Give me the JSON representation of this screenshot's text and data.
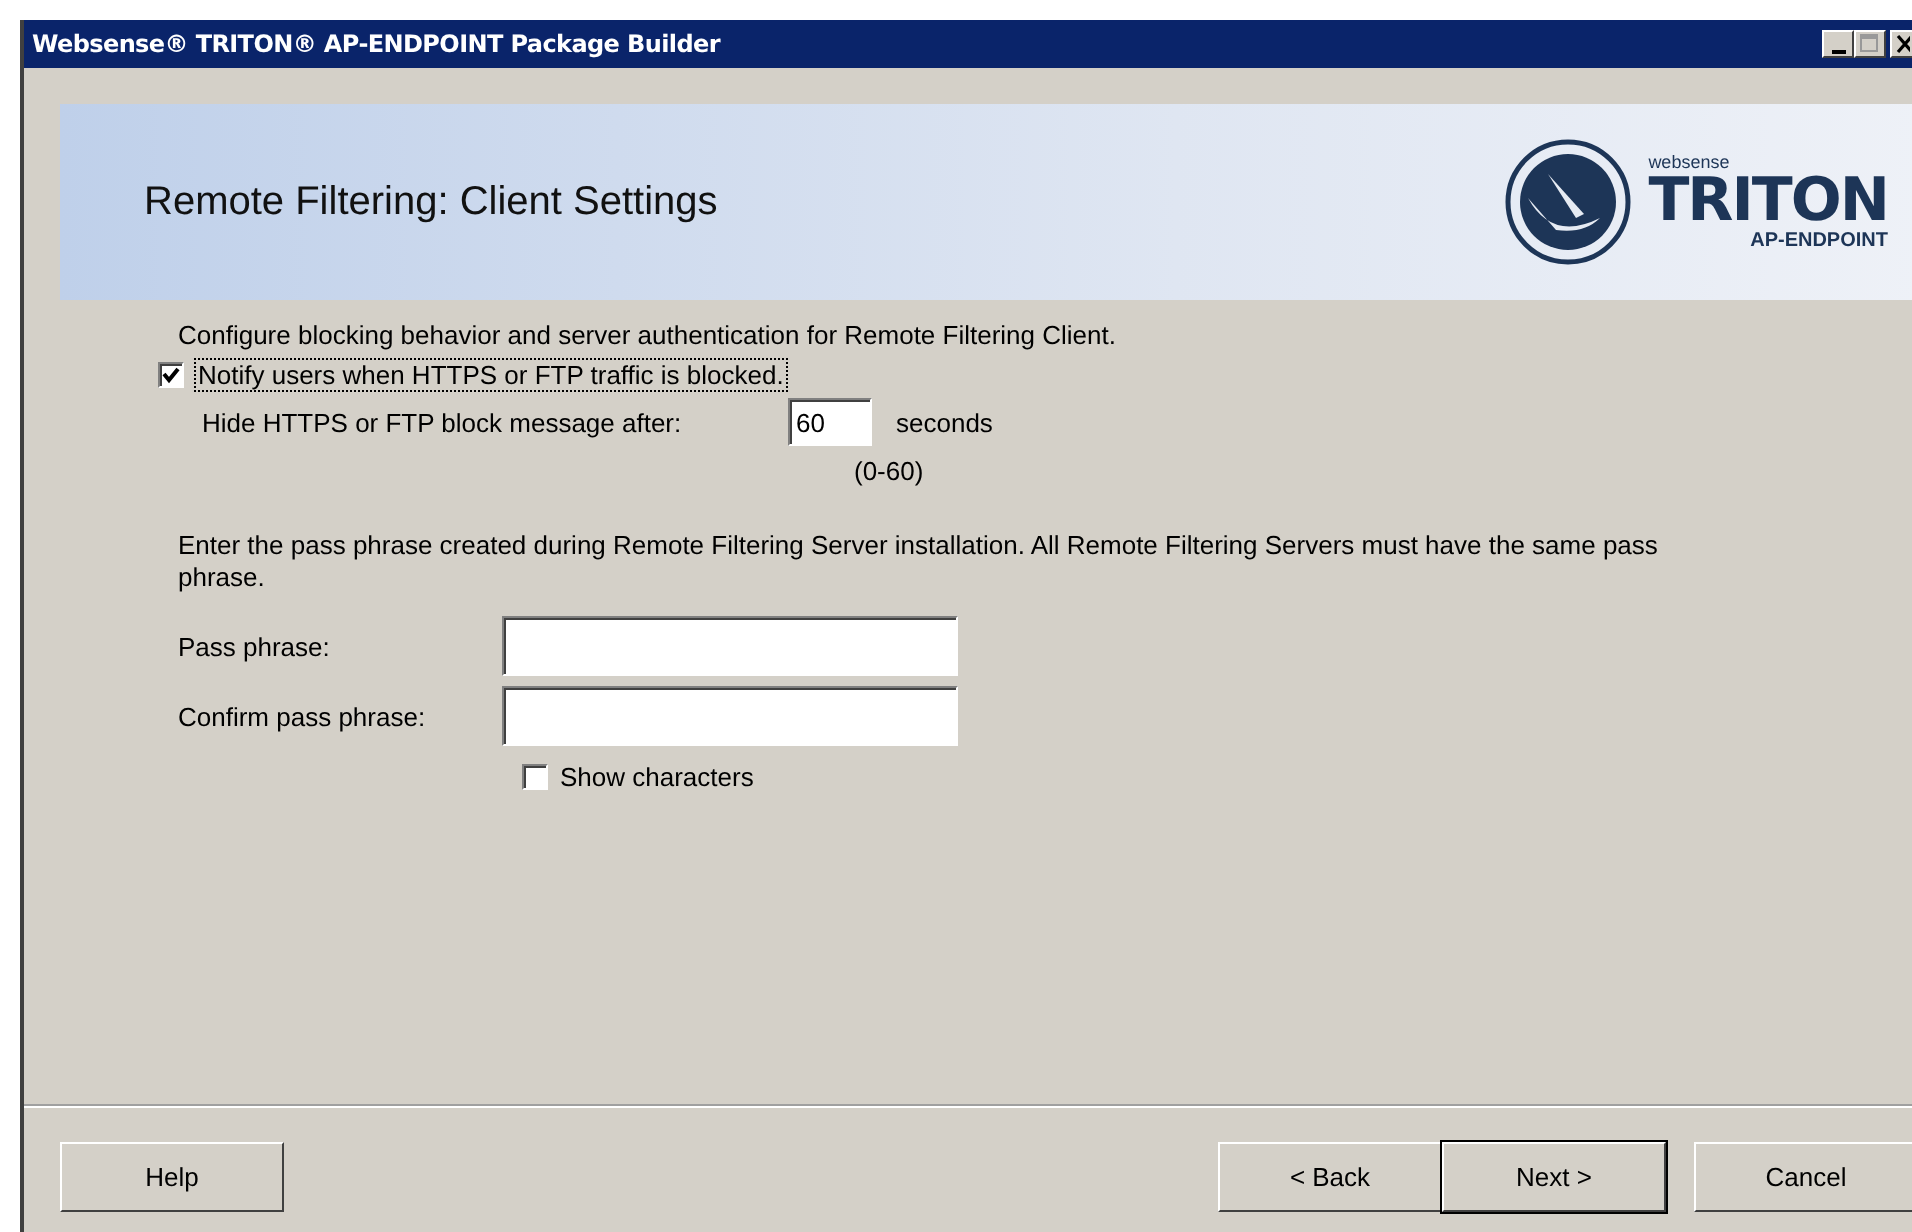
{
  "window": {
    "title": "Websense® TRITON® AP-ENDPOINT Package Builder"
  },
  "header": {
    "title": "Remote Filtering: Client Settings",
    "logo_small": "websense",
    "logo_big": "TRITON",
    "logo_sub": "AP-ENDPOINT"
  },
  "intro": "Configure blocking behavior and server authentication for Remote Filtering Client.",
  "notify": {
    "label": "Notify users when HTTPS or FTP traffic is blocked.",
    "checked": true
  },
  "hide": {
    "label": "Hide HTTPS or FTP block message after:",
    "value": "60",
    "unit": "seconds",
    "range": "(0-60)"
  },
  "passphrase_intro": "Enter the pass phrase created during Remote Filtering Server installation.  All Remote Filtering Servers must have the same pass phrase.",
  "fields": [
    {
      "label": "Pass phrase:"
    },
    {
      "label": "Confirm pass phrase:"
    }
  ],
  "show_characters": {
    "label": "Show characters",
    "checked": false
  },
  "buttons": [
    {
      "label": "Help",
      "default": false
    },
    {
      "label": "< Back",
      "default": false
    },
    {
      "label": "Next >",
      "default": true
    },
    {
      "label": "Cancel",
      "default": false
    }
  ]
}
